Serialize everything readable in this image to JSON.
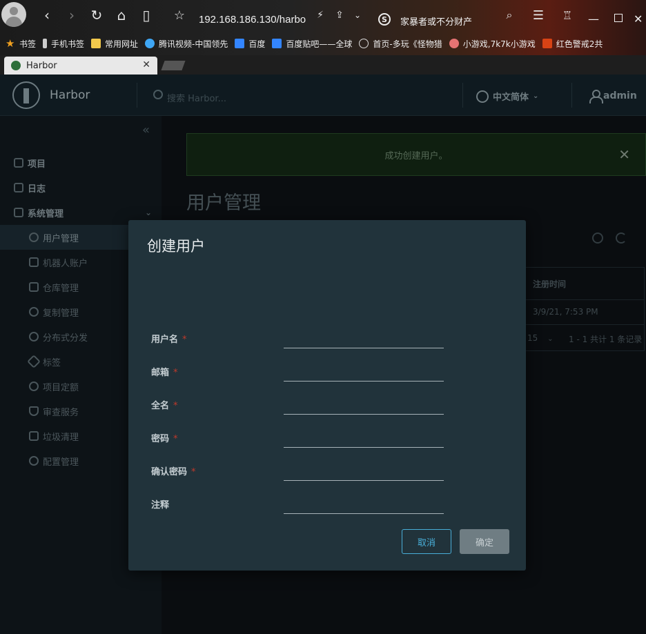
{
  "browser": {
    "url": "192.168.186.130/harbo",
    "search_text": "家暴者或不分财产",
    "search_engine": "S",
    "tab_title": "Harbor",
    "bookmarks": [
      {
        "label": "书签",
        "icon": "star-icon",
        "color": "#f0a020"
      },
      {
        "label": "手机书签",
        "icon": "phone-icon",
        "color": "#cccccc"
      },
      {
        "label": "常用网址",
        "icon": "folder-icon",
        "color": "#f2c94c"
      },
      {
        "label": "腾讯视频-中国领先",
        "icon": "tencent-video-icon",
        "color": "#3fa7f5"
      },
      {
        "label": "百度",
        "icon": "baidu-icon",
        "color": "#3385ff"
      },
      {
        "label": "百度贴吧——全球",
        "icon": "baidu-icon",
        "color": "#3385ff"
      },
      {
        "label": "首页-多玩《怪物猎",
        "icon": "globe-icon",
        "color": "#dddddd"
      },
      {
        "label": "小游戏,7k7k小游戏",
        "icon": "game-icon",
        "color": "#e57373"
      },
      {
        "label": "红色警戒2共",
        "icon": "jia-icon",
        "color": "#d84315"
      }
    ]
  },
  "header": {
    "brand": "Harbor",
    "search_placeholder": "搜索 Harbor...",
    "language": "中文简体",
    "user": "admin"
  },
  "sidebar": {
    "items": [
      {
        "label": "项目",
        "level": "top"
      },
      {
        "label": "日志",
        "level": "top"
      },
      {
        "label": "系统管理",
        "level": "top"
      },
      {
        "label": "用户管理",
        "level": "sub",
        "active": true
      },
      {
        "label": "机器人账户",
        "level": "sub"
      },
      {
        "label": "仓库管理",
        "level": "sub"
      },
      {
        "label": "复制管理",
        "level": "sub"
      },
      {
        "label": "分布式分发",
        "level": "sub"
      },
      {
        "label": "标签",
        "level": "sub"
      },
      {
        "label": "项目定额",
        "level": "sub"
      },
      {
        "label": "审查服务",
        "level": "sub"
      },
      {
        "label": "垃圾清理",
        "level": "sub"
      },
      {
        "label": "配置管理",
        "level": "sub"
      }
    ]
  },
  "main": {
    "alert": "成功创建用户。",
    "title": "用户管理",
    "table": {
      "column_registered": "注册时间",
      "cell_registered": "3/9/21, 7:53 PM",
      "page_size": "15",
      "pagination": "1 - 1 共计 1 条记录"
    }
  },
  "modal": {
    "title": "创建用户",
    "fields": [
      {
        "label": "用户名",
        "required": true,
        "value": ""
      },
      {
        "label": "邮箱",
        "required": true,
        "value": ""
      },
      {
        "label": "全名",
        "required": true,
        "value": ""
      },
      {
        "label": "密码",
        "required": true,
        "value": ""
      },
      {
        "label": "确认密码",
        "required": true,
        "value": ""
      },
      {
        "label": "注释",
        "required": false,
        "value": ""
      }
    ],
    "required_mark": "*",
    "cancel": "取消",
    "ok": "确定"
  }
}
